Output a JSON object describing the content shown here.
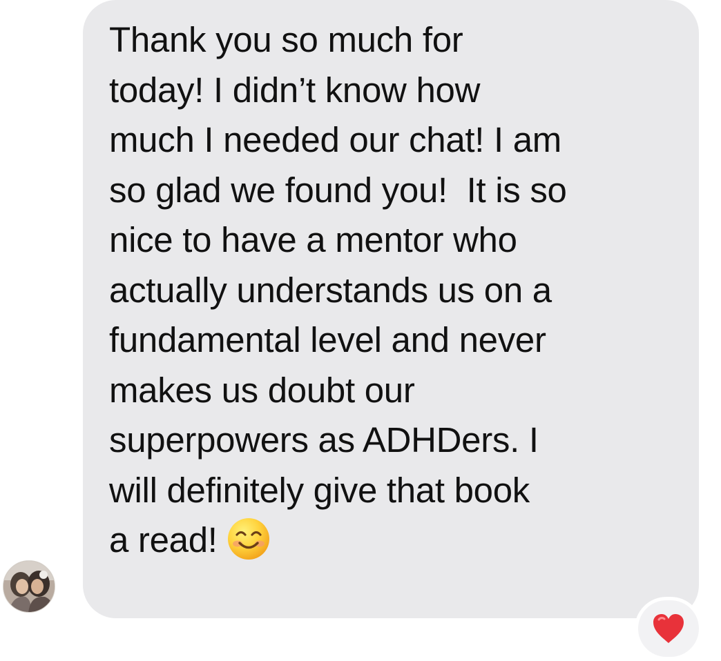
{
  "conversation": {
    "message": {
      "lines": [
        "Thank you so much for",
        "today! I didn’t know how",
        "much I needed our chat! I am",
        "so glad we found you!  It is so",
        "nice to have a mentor who",
        "actually understands us on a",
        "fundamental level and never",
        "makes us doubt our",
        "superpowers as ADHDers. I",
        "will definitely give that book",
        "a read!"
      ],
      "emoji": "smiling-face-emoji",
      "reaction": "red-heart-icon"
    },
    "sender": {
      "avatar": "profile-photo"
    }
  },
  "colors": {
    "bubble_background": "#e9e9eb",
    "text": "#111111",
    "heart": "#e8323a"
  }
}
